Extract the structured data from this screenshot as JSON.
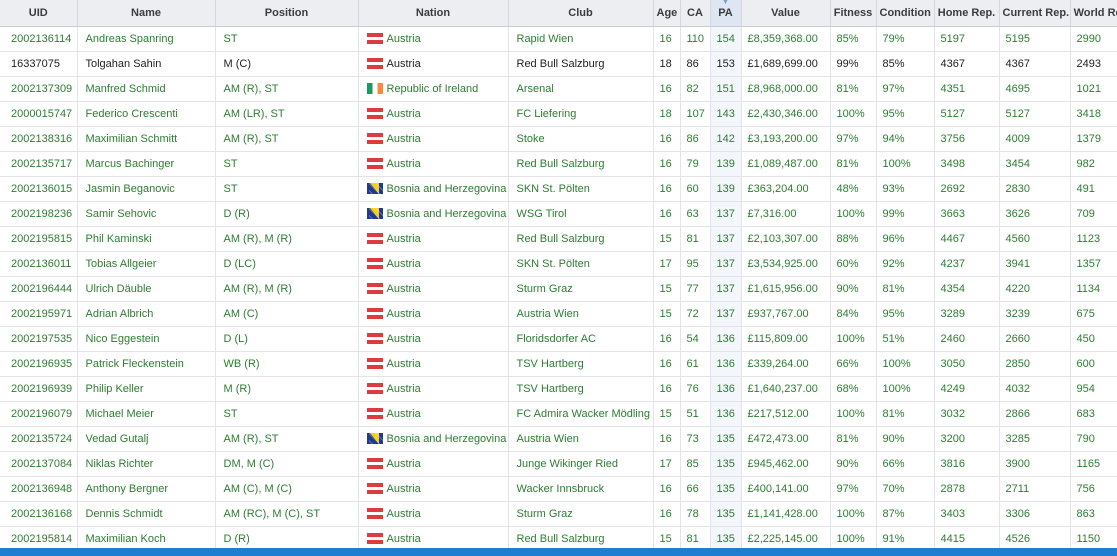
{
  "columns": [
    "UID",
    "Name",
    "Position",
    "Nation",
    "Club",
    "Age",
    "CA",
    "PA",
    "Value",
    "Fitness",
    "Condition",
    "Home Rep.",
    "Current Rep.",
    "World Rep."
  ],
  "sorted_column": "PA",
  "nation_flags": {
    "Austria": "flag-austria",
    "Republic of Ireland": "flag-ireland",
    "Bosnia and Herzegovina": "flag-bosnia"
  },
  "colors": {
    "text_green": "#2e7d32",
    "accent_blue": "#1e7fd2",
    "header_bg": "#edeef1"
  },
  "rows": [
    {
      "uid": "2002136114",
      "name": "Andreas Spanring",
      "position": "ST",
      "nation": "Austria",
      "club": "Rapid Wien",
      "age": "16",
      "ca": "110",
      "pa": "154",
      "value": "£8,359,368.00",
      "fitness": "85%",
      "condition": "79%",
      "home_rep": "5197",
      "current_rep": "5195",
      "world_rep": "2990"
    },
    {
      "uid": "16337075",
      "name": "Tolgahan Sahin",
      "position": "M (C)",
      "nation": "Austria",
      "club": "Red Bull Salzburg",
      "age": "18",
      "ca": "86",
      "pa": "153",
      "value": "£1,689,699.00",
      "fitness": "99%",
      "condition": "85%",
      "home_rep": "4367",
      "current_rep": "4367",
      "world_rep": "2493",
      "plain": true
    },
    {
      "uid": "2002137309",
      "name": "Manfred Schmid",
      "position": "AM (R), ST",
      "nation": "Republic of Ireland",
      "club": "Arsenal",
      "age": "16",
      "ca": "82",
      "pa": "151",
      "value": "£8,968,000.00",
      "fitness": "81%",
      "condition": "97%",
      "home_rep": "4351",
      "current_rep": "4695",
      "world_rep": "1021"
    },
    {
      "uid": "2000015747",
      "name": "Federico Crescenti",
      "position": "AM (LR), ST",
      "nation": "Austria",
      "club": "FC Liefering",
      "age": "18",
      "ca": "107",
      "pa": "143",
      "value": "£2,430,346.00",
      "fitness": "100%",
      "condition": "95%",
      "home_rep": "5127",
      "current_rep": "5127",
      "world_rep": "3418"
    },
    {
      "uid": "2002138316",
      "name": "Maximilian Schmitt",
      "position": "AM (R), ST",
      "nation": "Austria",
      "club": "Stoke",
      "age": "16",
      "ca": "86",
      "pa": "142",
      "value": "£3,193,200.00",
      "fitness": "97%",
      "condition": "94%",
      "home_rep": "3756",
      "current_rep": "4009",
      "world_rep": "1379"
    },
    {
      "uid": "2002135717",
      "name": "Marcus Bachinger",
      "position": "ST",
      "nation": "Austria",
      "club": "Red Bull Salzburg",
      "age": "16",
      "ca": "79",
      "pa": "139",
      "value": "£1,089,487.00",
      "fitness": "81%",
      "condition": "100%",
      "home_rep": "3498",
      "current_rep": "3454",
      "world_rep": "982"
    },
    {
      "uid": "2002136015",
      "name": "Jasmin Beganovic",
      "position": "ST",
      "nation": "Bosnia and Herzegovina",
      "club": "SKN St. Pölten",
      "age": "16",
      "ca": "60",
      "pa": "139",
      "value": "£363,204.00",
      "fitness": "48%",
      "condition": "93%",
      "home_rep": "2692",
      "current_rep": "2830",
      "world_rep": "491"
    },
    {
      "uid": "2002198236",
      "name": "Samir Sehovic",
      "position": "D (R)",
      "nation": "Bosnia and Herzegovina",
      "club": "WSG Tirol",
      "age": "16",
      "ca": "63",
      "pa": "137",
      "value": "£7,316.00",
      "fitness": "100%",
      "condition": "99%",
      "home_rep": "3663",
      "current_rep": "3626",
      "world_rep": "709"
    },
    {
      "uid": "2002195815",
      "name": "Phil Kaminski",
      "position": "AM (R), M (R)",
      "nation": "Austria",
      "club": "Red Bull Salzburg",
      "age": "15",
      "ca": "81",
      "pa": "137",
      "value": "£2,103,307.00",
      "fitness": "88%",
      "condition": "96%",
      "home_rep": "4467",
      "current_rep": "4560",
      "world_rep": "1123"
    },
    {
      "uid": "2002136011",
      "name": "Tobias Allgeier",
      "position": "D (LC)",
      "nation": "Austria",
      "club": "SKN St. Pölten",
      "age": "17",
      "ca": "95",
      "pa": "137",
      "value": "£3,534,925.00",
      "fitness": "60%",
      "condition": "92%",
      "home_rep": "4237",
      "current_rep": "3941",
      "world_rep": "1357"
    },
    {
      "uid": "2002196444",
      "name": "Ulrich Däuble",
      "position": "AM (R), M (R)",
      "nation": "Austria",
      "club": "Sturm Graz",
      "age": "15",
      "ca": "77",
      "pa": "137",
      "value": "£1,615,956.00",
      "fitness": "90%",
      "condition": "81%",
      "home_rep": "4354",
      "current_rep": "4220",
      "world_rep": "1134"
    },
    {
      "uid": "2002195971",
      "name": "Adrian Albrich",
      "position": "AM (C)",
      "nation": "Austria",
      "club": "Austria Wien",
      "age": "15",
      "ca": "72",
      "pa": "137",
      "value": "£937,767.00",
      "fitness": "84%",
      "condition": "95%",
      "home_rep": "3289",
      "current_rep": "3239",
      "world_rep": "675"
    },
    {
      "uid": "2002197535",
      "name": "Nico Eggestein",
      "position": "D (L)",
      "nation": "Austria",
      "club": "Floridsdorfer AC",
      "age": "16",
      "ca": "54",
      "pa": "136",
      "value": "£115,809.00",
      "fitness": "100%",
      "condition": "51%",
      "home_rep": "2460",
      "current_rep": "2660",
      "world_rep": "450"
    },
    {
      "uid": "2002196935",
      "name": "Patrick Fleckenstein",
      "position": "WB (R)",
      "nation": "Austria",
      "club": "TSV Hartberg",
      "age": "16",
      "ca": "61",
      "pa": "136",
      "value": "£339,264.00",
      "fitness": "66%",
      "condition": "100%",
      "home_rep": "3050",
      "current_rep": "2850",
      "world_rep": "600"
    },
    {
      "uid": "2002196939",
      "name": "Philip Keller",
      "position": "M (R)",
      "nation": "Austria",
      "club": "TSV Hartberg",
      "age": "16",
      "ca": "76",
      "pa": "136",
      "value": "£1,640,237.00",
      "fitness": "68%",
      "condition": "100%",
      "home_rep": "4249",
      "current_rep": "4032",
      "world_rep": "954"
    },
    {
      "uid": "2002196079",
      "name": "Michael Meier",
      "position": "ST",
      "nation": "Austria",
      "club": "FC Admira Wacker Mödling",
      "age": "15",
      "ca": "51",
      "pa": "136",
      "value": "£217,512.00",
      "fitness": "100%",
      "condition": "81%",
      "home_rep": "3032",
      "current_rep": "2866",
      "world_rep": "683"
    },
    {
      "uid": "2002135724",
      "name": "Vedad Gutalj",
      "position": "AM (R), ST",
      "nation": "Bosnia and Herzegovina",
      "club": "Austria Wien",
      "age": "16",
      "ca": "73",
      "pa": "135",
      "value": "£472,473.00",
      "fitness": "81%",
      "condition": "90%",
      "home_rep": "3200",
      "current_rep": "3285",
      "world_rep": "790"
    },
    {
      "uid": "2002137084",
      "name": "Niklas Richter",
      "position": "DM, M (C)",
      "nation": "Austria",
      "club": "Junge Wikinger Ried",
      "age": "17",
      "ca": "85",
      "pa": "135",
      "value": "£945,462.00",
      "fitness": "90%",
      "condition": "66%",
      "home_rep": "3816",
      "current_rep": "3900",
      "world_rep": "1165"
    },
    {
      "uid": "2002136948",
      "name": "Anthony Bergner",
      "position": "AM (C), M (C)",
      "nation": "Austria",
      "club": "Wacker Innsbruck",
      "age": "16",
      "ca": "66",
      "pa": "135",
      "value": "£400,141.00",
      "fitness": "97%",
      "condition": "70%",
      "home_rep": "2878",
      "current_rep": "2711",
      "world_rep": "756"
    },
    {
      "uid": "2002136168",
      "name": "Dennis Schmidt",
      "position": "AM (RC), M (C), ST",
      "nation": "Austria",
      "club": "Sturm Graz",
      "age": "16",
      "ca": "78",
      "pa": "135",
      "value": "£1,141,428.00",
      "fitness": "100%",
      "condition": "87%",
      "home_rep": "3403",
      "current_rep": "3306",
      "world_rep": "863"
    },
    {
      "uid": "2002195814",
      "name": "Maximilian Koch",
      "position": "D (R)",
      "nation": "Austria",
      "club": "Red Bull Salzburg",
      "age": "15",
      "ca": "81",
      "pa": "135",
      "value": "£2,225,145.00",
      "fitness": "100%",
      "condition": "91%",
      "home_rep": "4415",
      "current_rep": "4526",
      "world_rep": "1150"
    }
  ]
}
